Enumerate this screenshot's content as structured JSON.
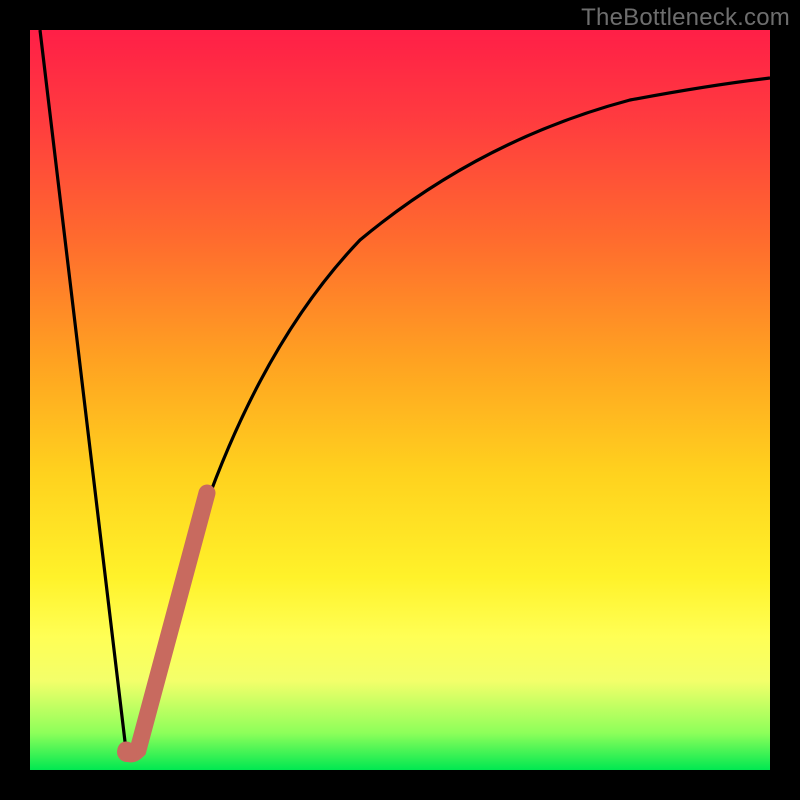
{
  "watermark": {
    "text": "TheBottleneck.com"
  },
  "colors": {
    "frame": "#000000",
    "curve": "#000000",
    "highlight": "#c86a5f",
    "gradient_stops": [
      "#ff1f47",
      "#ff3b3f",
      "#ff6a2e",
      "#ffa321",
      "#ffd21e",
      "#fff22a",
      "#ffff55",
      "#f3ff6a",
      "#8dff5a",
      "#00e851"
    ]
  },
  "chart_data": {
    "type": "line",
    "title": "",
    "xlabel": "",
    "ylabel": "",
    "xlim": [
      0,
      100
    ],
    "ylim": [
      0,
      100
    ],
    "grid": false,
    "series": [
      {
        "name": "bottleneck-curve",
        "x": [
          0,
          2,
          4,
          6,
          8,
          10,
          12,
          13,
          14,
          16,
          18,
          20,
          22,
          24,
          26,
          28,
          30,
          34,
          38,
          42,
          46,
          50,
          55,
          60,
          65,
          70,
          75,
          80,
          85,
          90,
          95,
          100
        ],
        "values": [
          100,
          85,
          70,
          56,
          42,
          28,
          14,
          2,
          2,
          8,
          16,
          24,
          32,
          40,
          47,
          53,
          58,
          66,
          72,
          76,
          79,
          82,
          84,
          86,
          87.5,
          88.5,
          89.3,
          90,
          90.5,
          90.8,
          91,
          91.2
        ]
      }
    ],
    "highlight_segment": {
      "series": "bottleneck-curve",
      "x_start": 13,
      "x_end": 24,
      "note": "thick salmon overlay along curve near minimum"
    },
    "minimum": {
      "x": 13.5,
      "y": 2
    }
  }
}
